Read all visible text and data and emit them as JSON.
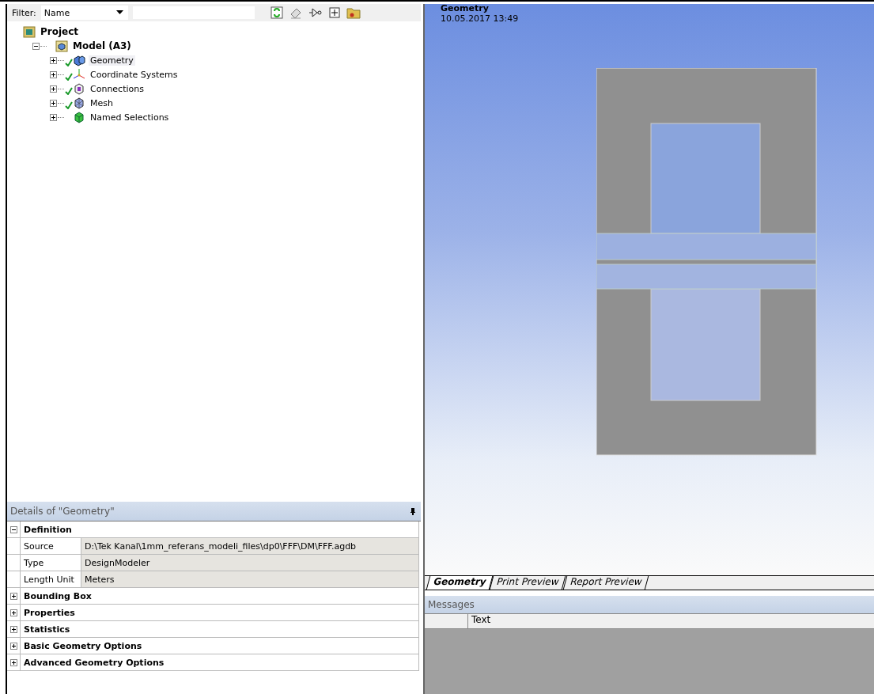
{
  "filter": {
    "label": "Filter:",
    "value": "Name"
  },
  "tree": [
    {
      "label": "Project",
      "kind": "project",
      "children": [
        {
          "label": "Model (A3)",
          "kind": "model",
          "expanded": true,
          "children": [
            {
              "label": "Geometry",
              "kind": "geometry",
              "expanded": false,
              "checked": true,
              "selected": true
            },
            {
              "label": "Coordinate Systems",
              "kind": "coordinates",
              "expanded": false,
              "checked": true,
              "selected": false
            },
            {
              "label": "Connections",
              "kind": "connections",
              "expanded": false,
              "checked": true,
              "selected": false
            },
            {
              "label": "Mesh",
              "kind": "mesh",
              "expanded": false,
              "checked": true,
              "selected": false
            },
            {
              "label": "Named Selections",
              "kind": "selections",
              "expanded": false,
              "checked": false,
              "selected": false
            }
          ]
        }
      ]
    }
  ],
  "details": {
    "title": "Details of \"Geometry\"",
    "groups": [
      {
        "label": "Definition",
        "expanded": true,
        "rows": [
          {
            "name": "Source",
            "value": "D:\\Tek Kanal\\1mm_referans_modeli_files\\dp0\\FFF\\DM\\FFF.agdb"
          },
          {
            "name": "Type",
            "value": "DesignModeler"
          },
          {
            "name": "Length Unit",
            "value": "Meters"
          }
        ]
      },
      {
        "label": "Bounding Box",
        "expanded": false
      },
      {
        "label": "Properties",
        "expanded": false
      },
      {
        "label": "Statistics",
        "expanded": false
      },
      {
        "label": "Basic Geometry Options",
        "expanded": false
      },
      {
        "label": "Advanced Geometry Options",
        "expanded": false
      }
    ]
  },
  "viewport": {
    "title": "Geometry",
    "timestamp": "10.05.2017 13:49"
  },
  "tabs": [
    {
      "label": "Geometry",
      "selected": true
    },
    {
      "label": "Print Preview",
      "selected": false
    },
    {
      "label": "Report Preview",
      "selected": false
    }
  ],
  "messages": {
    "title": "Messages",
    "columns": [
      "Text"
    ]
  }
}
